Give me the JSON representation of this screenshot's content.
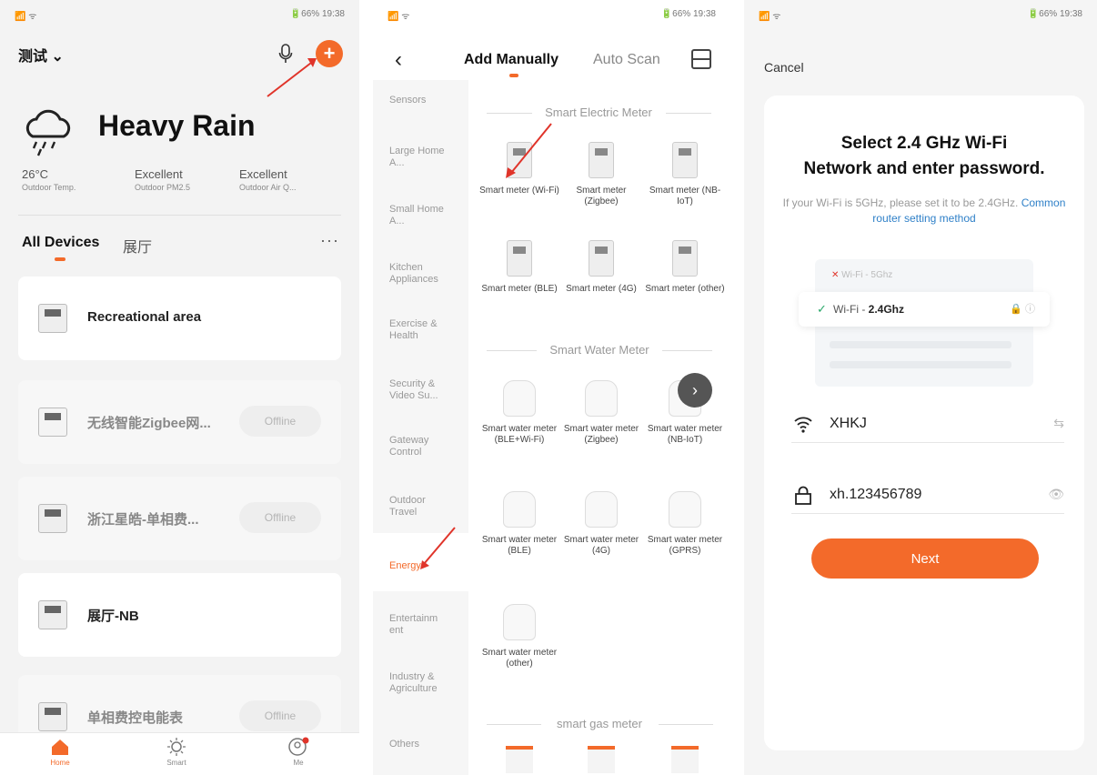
{
  "screen1": {
    "status_left": "📶 ᯤ",
    "status_right": "🔋66% 19:38",
    "home_name": "测试",
    "weather": {
      "title": "Heavy Rain",
      "stats": [
        {
          "value": "26°C",
          "label": "Outdoor Temp."
        },
        {
          "value": "Excellent",
          "label": "Outdoor PM2.5"
        },
        {
          "value": "Excellent",
          "label": "Outdoor Air Q..."
        }
      ]
    },
    "tabs": {
      "all": "All Devices",
      "second": "展厅",
      "more": "···"
    },
    "devices": [
      {
        "name": "Recreational area",
        "status": ""
      },
      {
        "name": "无线智能Zigbee网...",
        "status": "Offline"
      },
      {
        "name": "浙江星皓-单相费...",
        "status": "Offline"
      },
      {
        "name": "展厅-NB",
        "status": ""
      },
      {
        "name": "单相费控电能表",
        "status": "Offline"
      }
    ],
    "nav": [
      "Home",
      "Smart",
      "Me"
    ],
    "colors": {
      "accent": "#f36a2a"
    }
  },
  "screen2": {
    "status_left": "📶 ᯤ",
    "status_right": "🔋66% 19:38",
    "tabs": {
      "manual": "Add Manually",
      "scan": "Auto Scan"
    },
    "categories": [
      "Sensors",
      "Large Home A...",
      "Small Home A...",
      "Kitchen Appliances",
      "Exercise & Health",
      "Security & Video Su...",
      "Gateway Control",
      "Outdoor Travel",
      "Energy",
      "Entertainm ent",
      "Industry & Agriculture",
      "Others"
    ],
    "sections": {
      "electric": "Smart Electric Meter",
      "water": "Smart Water Meter",
      "gas": "smart gas meter"
    },
    "electric_products": [
      "Smart meter (Wi-Fi)",
      "Smart meter (Zigbee)",
      "Smart meter (NB-IoT)",
      "Smart meter (BLE)",
      "Smart meter (4G)",
      "Smart meter (other)"
    ],
    "water_products": [
      "Smart water meter (BLE+Wi-Fi)",
      "Smart water meter (Zigbee)",
      "Smart water meter (NB-IoT)",
      "Smart water meter (BLE)",
      "Smart water meter (4G)",
      "Smart water meter (GPRS)",
      "Smart water meter (other)"
    ]
  },
  "screen3": {
    "status_left": "📶 ᯤ",
    "status_right": "🔋66% 19:38",
    "cancel": "Cancel",
    "title_line1": "Select 2.4 GHz Wi-Fi",
    "title_line2": "Network and enter password.",
    "hint": "If your Wi-Fi is 5GHz, please set it to be 2.4GHz.",
    "hint_link": "Common router setting method",
    "wifi_5g": "Wi-Fi - 5Ghz",
    "wifi_24_prefix": "Wi-Fi - ",
    "wifi_24": "2.4Ghz",
    "ssid": "XHKJ",
    "password": "xh.123456789",
    "next": "Next"
  }
}
